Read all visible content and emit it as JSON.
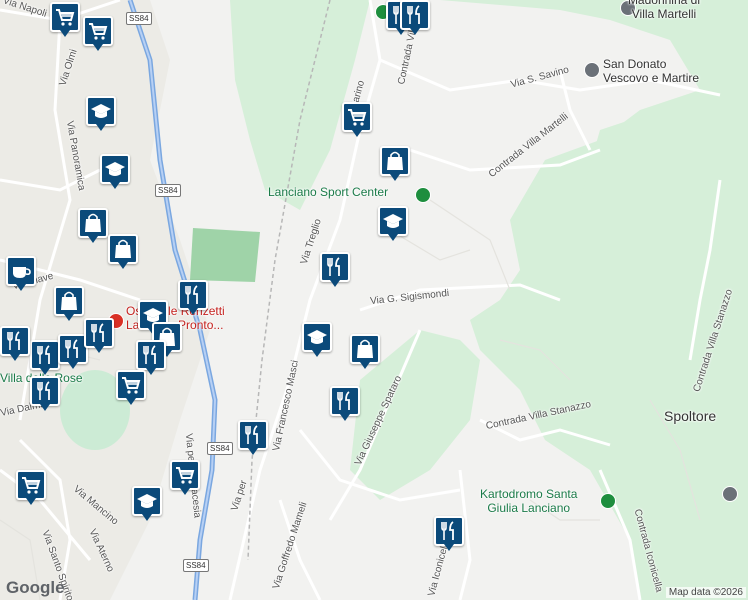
{
  "map": {
    "attribution": "Map data ©2026",
    "logo": "Google",
    "places": [
      {
        "id": "madonnina",
        "text": "Madonnina di\nVilla Martelli",
        "kind": "place"
      },
      {
        "id": "san-donato",
        "text": "San Donato\nVescovo e Martire",
        "kind": "place"
      },
      {
        "id": "sport-center",
        "text": "Lanciano Sport Center",
        "kind": "poi"
      },
      {
        "id": "spoltore",
        "text": "Spoltore",
        "kind": "place"
      },
      {
        "id": "kartodromo",
        "text": "Kartodromo Santa\nGiulia Lanciano",
        "kind": "poi"
      },
      {
        "id": "ospedale",
        "text": "Ospedale Renzetti\nLanciano Pronto...",
        "kind": "red"
      },
      {
        "id": "villa-delle-rose",
        "text": "Villa delle Rose",
        "kind": "poi"
      }
    ],
    "roads": [
      {
        "id": "via-napoli",
        "text": "Via Napoli"
      },
      {
        "id": "via-olmi",
        "text": "Via Olmi"
      },
      {
        "id": "via-panoramica",
        "text": "Via Panoramica"
      },
      {
        "id": "via-s-savino",
        "text": "Via S. Savino"
      },
      {
        "id": "contrada-villa-martelli",
        "text": "Contrada Villa Martelli"
      },
      {
        "id": "contrada-villa-a",
        "text": "Contrada Villa"
      },
      {
        "id": "via-treglio",
        "text": "Via Treglio"
      },
      {
        "id": "via-g-sigismondi",
        "text": "Via G. Sigismondi"
      },
      {
        "id": "via-francesco-masci",
        "text": "Via Francesco Masci"
      },
      {
        "id": "via-giuseppe-spataro",
        "text": "Via Giuseppe Spataro"
      },
      {
        "id": "contrada-villa-stanazzo",
        "text": "Contrada Villa Stanazzo"
      },
      {
        "id": "contrada-villa-stanazzo-2",
        "text": "Contrada Villa Stanazzo"
      },
      {
        "id": "via-goffredo-mameli",
        "text": "Via Goffredo Mameli"
      },
      {
        "id": "via-mancino",
        "text": "Via Mancino"
      },
      {
        "id": "via-aterno",
        "text": "Via Aterno"
      },
      {
        "id": "via-santo-spirito",
        "text": "Via Santo Spirito"
      },
      {
        "id": "via-piave",
        "text": "Via Piave"
      },
      {
        "id": "via-dalmazia",
        "text": "Via Dalmazia"
      },
      {
        "id": "via-iconicella",
        "text": "Via Iconicella"
      },
      {
        "id": "contrada-iconicella",
        "text": "Contrada Iconicella"
      },
      {
        "id": "via-per-fossacesia",
        "text": "Via per Fossacesia"
      },
      {
        "id": "via-per",
        "text": "Via per"
      },
      {
        "id": "via-marino",
        "text": "Via Marino"
      }
    ],
    "shields": [
      "SS84",
      "SS84",
      "SS84",
      "SS84"
    ],
    "markers": [
      {
        "icon": "cart"
      },
      {
        "icon": "cart"
      },
      {
        "icon": "restaurant"
      },
      {
        "icon": "restaurant"
      },
      {
        "icon": "school"
      },
      {
        "icon": "cart"
      },
      {
        "icon": "bag"
      },
      {
        "icon": "school"
      },
      {
        "icon": "school"
      },
      {
        "icon": "bag"
      },
      {
        "icon": "bag"
      },
      {
        "icon": "restaurant"
      },
      {
        "icon": "cafe"
      },
      {
        "icon": "bag"
      },
      {
        "icon": "school"
      },
      {
        "icon": "restaurant"
      },
      {
        "icon": "bag"
      },
      {
        "icon": "restaurant"
      },
      {
        "icon": "restaurant"
      },
      {
        "icon": "restaurant"
      },
      {
        "icon": "restaurant"
      },
      {
        "icon": "restaurant"
      },
      {
        "icon": "school"
      },
      {
        "icon": "bag"
      },
      {
        "icon": "restaurant"
      },
      {
        "icon": "cart"
      },
      {
        "icon": "restaurant"
      },
      {
        "icon": "restaurant"
      },
      {
        "icon": "cart"
      },
      {
        "icon": "cart"
      },
      {
        "icon": "school"
      },
      {
        "icon": "restaurant"
      }
    ],
    "colors": {
      "marker": "#0b4a7a",
      "park": "#ccebd5",
      "forest": "#d6efd9",
      "road": "#ffffff",
      "highway": "#8ab4f8",
      "background": "#f2f2f0"
    }
  }
}
